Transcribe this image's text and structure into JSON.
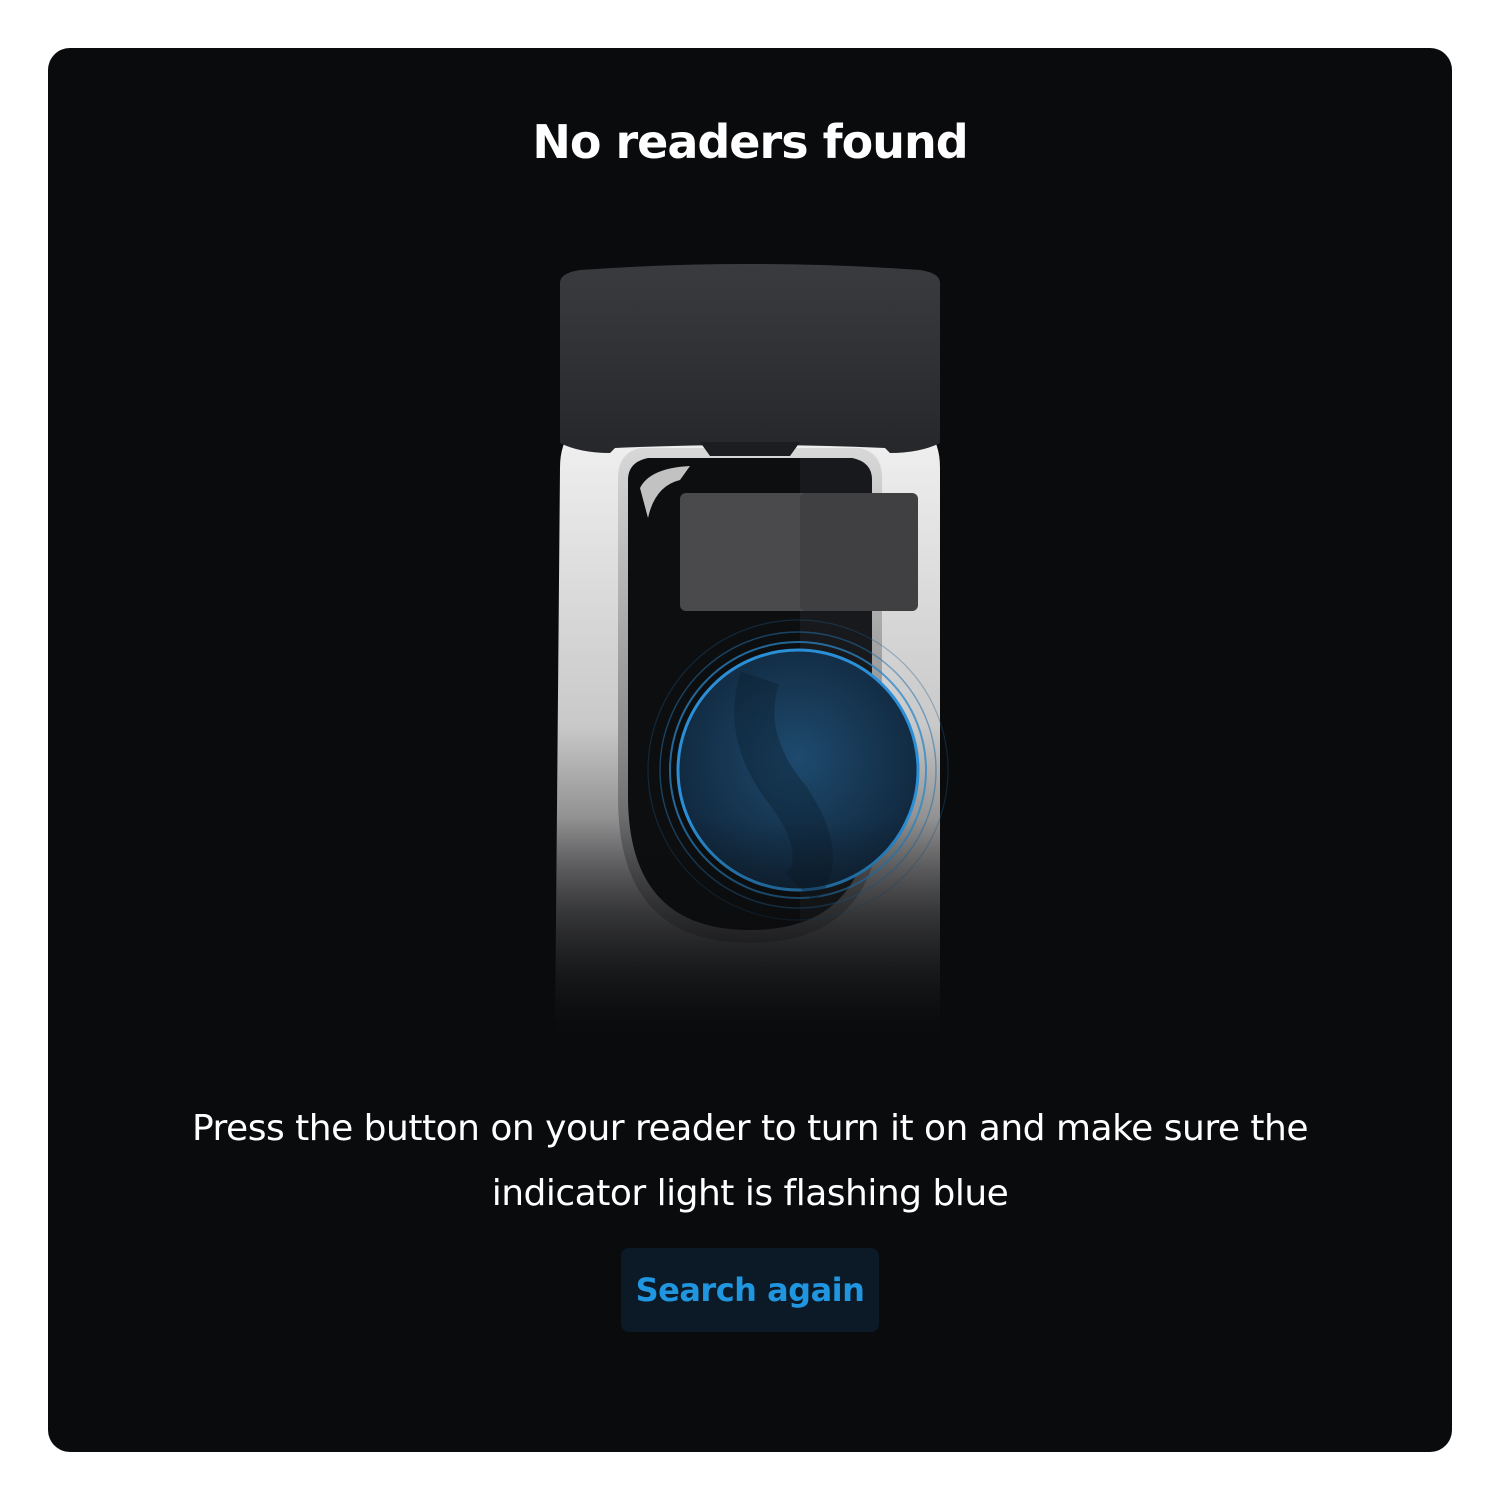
{
  "dialog": {
    "title": "No readers found",
    "message": "Press the button on your reader to turn it on and make sure the indicator light is flashing blue",
    "search_again_label": "Search again"
  },
  "colors": {
    "panel_background": "#0a0b0d",
    "title_text": "#ffffff",
    "button_background": "#0b1a26",
    "button_text": "#2196e0",
    "indicator_blue": "#2a8fd6"
  },
  "illustration": {
    "icon": "card-reader-illustration"
  }
}
